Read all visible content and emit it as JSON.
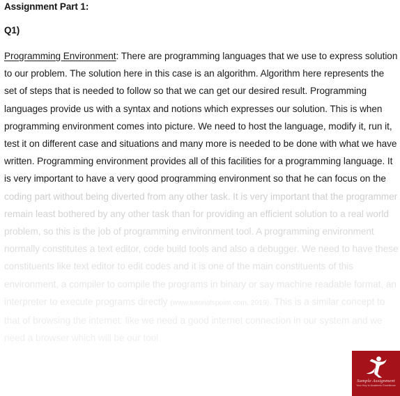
{
  "document": {
    "headings": {
      "assignment": "Assignment Part 1:",
      "question": "Q1)"
    },
    "answer": {
      "lead_term": "Programming Environment",
      "lead_separator": ": ",
      "body_visible": "There are programming languages that we use to express solution to our problem. The solution here in this case is an algorithm. Algorithm here represents the set of steps that is needed to follow so that we can get our desired result. Programming languages provide us with a syntax and notions which expresses our solution. This is when programming environment comes into picture. We need to host the language, modify it, run it, test it on different case and situations and many more is needed to be done with what we have written. Programming environment provides all of this ",
      "body_faded": "facilities for a programming language. It is very important to have a very good programming environment so that he can focus on the coding part without being diverted from any other task. It is very important that the programmer remain least bothered by any other task than for providing an efficient solution to a real world problem, so this is the job of programming environment tool. A programming environment normally constitutes a text editor, code build tools and also a debugger. We need to have these constituents like text editor to edit codes and it is one of the main constituents of this environment, a compiler to compile the programs in binary or say machine readable format, an interpreter to execute programs directly ",
      "citation": "(www.tutorialspoint.com, 2019)",
      "body_faded_tail": ". This is a similar concept to that of browsing the internet: like we need a good internet connection in our system and we need a browser which will be our tool"
    }
  },
  "watermark": {
    "brand": "Sample Assignment",
    "tagline": "Your Key to Academic Excellence",
    "background_color": "#a51219",
    "mark_name": "leaping-figure-logo"
  },
  "colors": {
    "text": "#1a1a1a",
    "faded_text": "#8d8d8d",
    "background": "#ffffff",
    "brand_red": "#a51219"
  }
}
